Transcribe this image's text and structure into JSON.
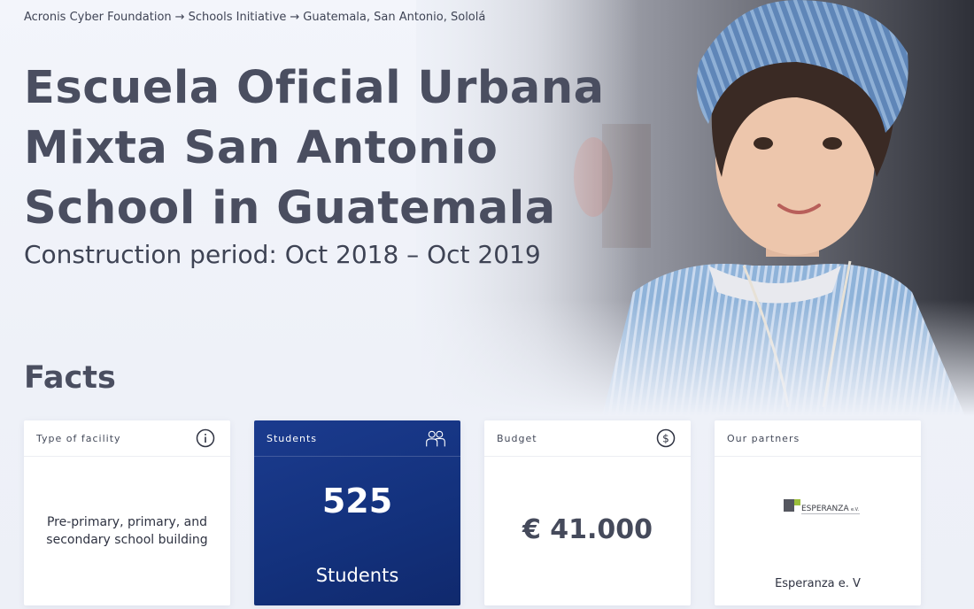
{
  "breadcrumb": {
    "items": [
      "Acronis Cyber Foundation",
      "Schools Initiative",
      "Guatemala, San Antonio, Sololá"
    ],
    "separator": "→"
  },
  "hero": {
    "title_lines": [
      "Escuela Oficial Urbana",
      "Mixta San Antonio",
      "School in Guatemala"
    ],
    "construction_period": "Construction period: Oct 2018 – Oct 2019"
  },
  "facts": {
    "heading": "Facts",
    "cards": {
      "facility": {
        "label": "Type of facility",
        "icon": "info-icon",
        "text": "Pre-primary, primary, and secondary school building"
      },
      "students": {
        "label": "Students",
        "icon": "people-icon",
        "number": "525",
        "caption": "Students"
      },
      "budget": {
        "label": "Budget",
        "icon": "dollar-icon",
        "amount": "€ 41.000"
      },
      "partners": {
        "label": "Our partners",
        "logo_text": "ESPERANZA",
        "logo_suffix": "e.V.",
        "name": "Esperanza e. V"
      }
    }
  },
  "colors": {
    "students_card": "#13317c",
    "title": "#4a4e60",
    "page_bg": "#eef1f8"
  }
}
